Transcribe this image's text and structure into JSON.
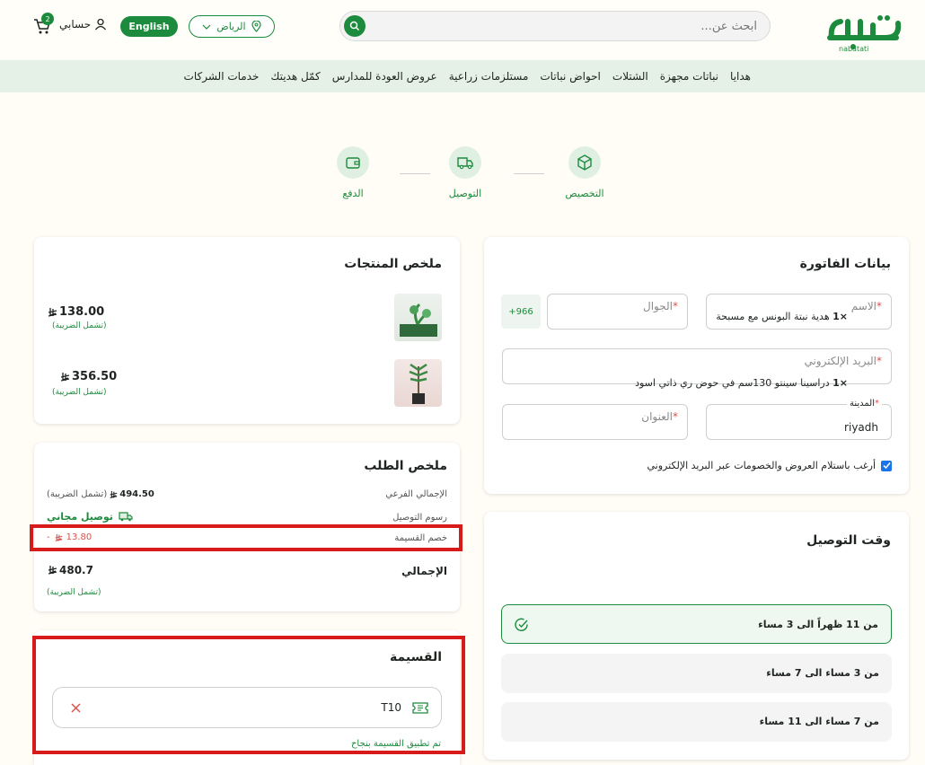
{
  "header": {
    "logo_text": "نباتاتي",
    "logo_sub": "nabatati",
    "search_placeholder": "ابحث عن...",
    "location": "الرياض",
    "language": "English",
    "account": "حسابي",
    "cart_count": "2"
  },
  "nav": [
    "هدايا",
    "نباتات مجهزة",
    "الشتلات",
    "احواض نباتات",
    "مستلزمات زراعية",
    "عروض العودة للمدارس",
    "كمّل هديتك",
    "خدمات الشركات"
  ],
  "steps": [
    {
      "label": "التخصيص",
      "icon": "box-icon"
    },
    {
      "label": "التوصيل",
      "icon": "truck-icon"
    },
    {
      "label": "الدفع",
      "icon": "wallet-icon"
    }
  ],
  "billing": {
    "title": "بيانات الفاتورة",
    "name_label": "الاسم",
    "phone_label": "الجوال",
    "phone_prefix": "+966",
    "email_label": "البريد الإلكتروني",
    "city_label": "المدينة",
    "city_value": "riyadh",
    "address_label": "العنوان",
    "required_mark": "*",
    "newsletter_label": "أرغب باستلام العروض والخصومات عبر البريد الإلكتروني"
  },
  "delivery_time": {
    "title": "وقت التوصيل",
    "slots": [
      "من 11 ظهراً الى 3 مساء",
      "من 3 مساء الى 7 مساء",
      "من 7 مساء الى 11 مساء"
    ]
  },
  "products": {
    "title": "ملخص المنتجات",
    "items": [
      {
        "qty": "×1",
        "name": "هدية نبتة البونس مع مسبحة",
        "price": "138.00",
        "tax": "(تشمل الضريبة)"
      },
      {
        "qty": "×1",
        "name": "دراسينا سينتو 130سم في حوض ري ذاتي اسود",
        "price": "356.50",
        "tax": "(تشمل الضريبة)"
      }
    ]
  },
  "order_summary": {
    "title": "ملخص الطلب",
    "subtotal_label": "الإجمالي الفرعي",
    "subtotal_value": "494.50",
    "subtotal_tax": "(تشمل الضريبة)",
    "shipping_label": "رسوم التوصيل",
    "shipping_value": "توصيل مجاني",
    "discount_label": "خصم القسيمة",
    "discount_value": "13.80",
    "discount_sign": "-",
    "total_label": "الإجمالي",
    "total_value": "480.7",
    "total_tax": "(تشمل الضريبة)"
  },
  "coupon": {
    "title": "القسيمة",
    "code": "T10",
    "success": "تم تطبيق القسيمة بنجاح"
  },
  "colors": {
    "brand": "#1d8b3d",
    "highlight": "#d71a1a",
    "discount": "#d9534f"
  }
}
